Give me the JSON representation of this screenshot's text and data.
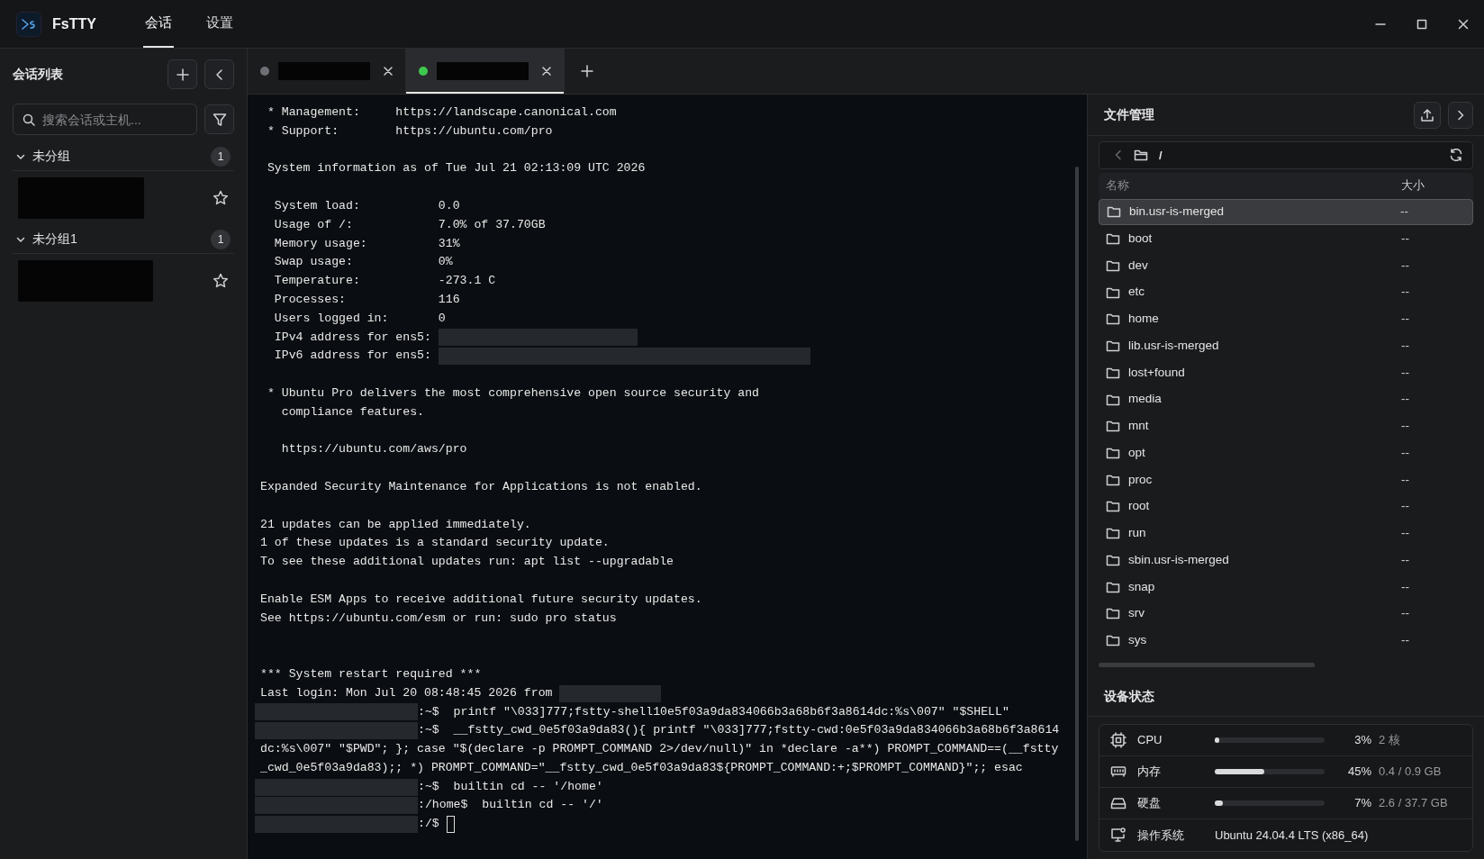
{
  "app": {
    "title": "FsTTY",
    "nav": [
      {
        "label": "会话",
        "selected": true
      },
      {
        "label": "设置",
        "selected": false
      }
    ]
  },
  "sidebar": {
    "title": "会话列表",
    "search": {
      "placeholder": "搜索会话或主机..."
    },
    "groups": [
      {
        "name": "未分组",
        "count": "1",
        "expanded": true,
        "sessions": [
          {
            "starred": false
          }
        ]
      },
      {
        "name": "未分组1",
        "count": "1",
        "expanded": true,
        "sessions": [
          {
            "starred": false
          }
        ]
      }
    ]
  },
  "tabs": [
    {
      "color": "#6e7076",
      "selected": false
    },
    {
      "color": "#3ec84f",
      "selected": true
    }
  ],
  "terminal": {
    "lines": [
      {
        "kind": "text",
        "text": " * Management:     https://landscape.canonical.com"
      },
      {
        "kind": "text",
        "text": " * Support:        https://ubuntu.com/pro"
      },
      {
        "kind": "blank"
      },
      {
        "kind": "text",
        "text": " System information as of Tue Jul 21 02:13:09 UTC 2026"
      },
      {
        "kind": "blank"
      },
      {
        "kind": "text",
        "text": "  System load:           0.0"
      },
      {
        "kind": "text",
        "text": "  Usage of /:            7.0% of 37.70GB"
      },
      {
        "kind": "text",
        "text": "  Memory usage:          31%"
      },
      {
        "kind": "text",
        "text": "  Swap usage:            0%"
      },
      {
        "kind": "text",
        "text": "  Temperature:           -273.1 C"
      },
      {
        "kind": "text",
        "text": "  Processes:             116"
      },
      {
        "kind": "text",
        "text": "  Users logged in:       0"
      },
      {
        "kind": "tailmedium",
        "text": "  IPv4 address for ens5: "
      },
      {
        "kind": "taillong",
        "text": "  IPv6 address for ens5: "
      },
      {
        "kind": "blank"
      },
      {
        "kind": "text",
        "text": " * Ubuntu Pro delivers the most comprehensive open source security and"
      },
      {
        "kind": "text",
        "text": "   compliance features."
      },
      {
        "kind": "blank"
      },
      {
        "kind": "text",
        "text": "   https://ubuntu.com/aws/pro"
      },
      {
        "kind": "blank"
      },
      {
        "kind": "text",
        "text": "Expanded Security Maintenance for Applications is not enabled."
      },
      {
        "kind": "blank"
      },
      {
        "kind": "text",
        "text": "21 updates can be applied immediately."
      },
      {
        "kind": "text",
        "text": "1 of these updates is a standard security update."
      },
      {
        "kind": "text",
        "text": "To see these additional updates run: apt list --upgradable"
      },
      {
        "kind": "blank"
      },
      {
        "kind": "text",
        "text": "Enable ESM Apps to receive additional future security updates."
      },
      {
        "kind": "text",
        "text": "See https://ubuntu.com/esm or run: sudo pro status"
      },
      {
        "kind": "blank"
      },
      {
        "kind": "blank"
      },
      {
        "kind": "text",
        "text": "*** System restart required ***"
      },
      {
        "kind": "tailshort",
        "text": "Last login: Mon Jul 20 08:48:45 2026 from "
      },
      {
        "kind": "prompt",
        "text": ":~$  printf \"\\033]777;fstty-shell10e5f03a9da834066b3a68b6f3a8614dc:%s\\007\" \"$SHELL\""
      },
      {
        "kind": "prompt",
        "text": ":~$  __fstty_cwd_0e5f03a9da83(){ printf \"\\033]777;fstty-cwd:0e5f03a9da834066b3a68b6f3a8614"
      },
      {
        "kind": "text",
        "text": "dc:%s\\007\" \"$PWD\"; }; case \"$(declare -p PROMPT_COMMAND 2>/dev/null)\" in *declare -a**) PROMPT_COMMAND==(__fstty"
      },
      {
        "kind": "text",
        "text": "_cwd_0e5f03a9da83);; *) PROMPT_COMMAND=\"__fstty_cwd_0e5f03a9da83${PROMPT_COMMAND:+;$PROMPT_COMMAND}\";; esac"
      },
      {
        "kind": "prompt",
        "text": ":~$  builtin cd -- '/home'"
      },
      {
        "kind": "prompt",
        "text": ":/home$  builtin cd -- '/'"
      },
      {
        "kind": "prompt",
        "text": ":/$ ",
        "cursor": true
      }
    ]
  },
  "file_manager": {
    "title": "文件管理",
    "path": "/",
    "columns": [
      "名称",
      "大小"
    ],
    "rows": [
      {
        "name": "bin.usr-is-merged",
        "size": "--",
        "selected": true
      },
      {
        "name": "boot",
        "size": "--",
        "selected": false
      },
      {
        "name": "dev",
        "size": "--",
        "selected": false
      },
      {
        "name": "etc",
        "size": "--",
        "selected": false
      },
      {
        "name": "home",
        "size": "--",
        "selected": false
      },
      {
        "name": "lib.usr-is-merged",
        "size": "--",
        "selected": false
      },
      {
        "name": "lost+found",
        "size": "--",
        "selected": false
      },
      {
        "name": "media",
        "size": "--",
        "selected": false
      },
      {
        "name": "mnt",
        "size": "--",
        "selected": false
      },
      {
        "name": "opt",
        "size": "--",
        "selected": false
      },
      {
        "name": "proc",
        "size": "--",
        "selected": false
      },
      {
        "name": "root",
        "size": "--",
        "selected": false
      },
      {
        "name": "run",
        "size": "--",
        "selected": false
      },
      {
        "name": "sbin.usr-is-merged",
        "size": "--",
        "selected": false
      },
      {
        "name": "snap",
        "size": "--",
        "selected": false
      },
      {
        "name": "srv",
        "size": "--",
        "selected": false
      },
      {
        "name": "sys",
        "size": "--",
        "selected": false
      }
    ]
  },
  "device_status": {
    "title": "设备状态",
    "items": [
      {
        "kind": "meter",
        "label": "CPU",
        "level": 0.03,
        "percent": "3%",
        "detail": "2 核"
      },
      {
        "kind": "meter",
        "label": "内存",
        "level": 0.45,
        "percent": "45%",
        "detail": "0.4 / 0.9 GB"
      },
      {
        "kind": "meter",
        "label": "硬盘",
        "level": 0.07,
        "percent": "7%",
        "detail": "2.6 / 37.7 GB"
      },
      {
        "kind": "info",
        "label": "操作系统",
        "value": "Ubuntu 24.04.4 LTS (x86_64)"
      }
    ]
  }
}
